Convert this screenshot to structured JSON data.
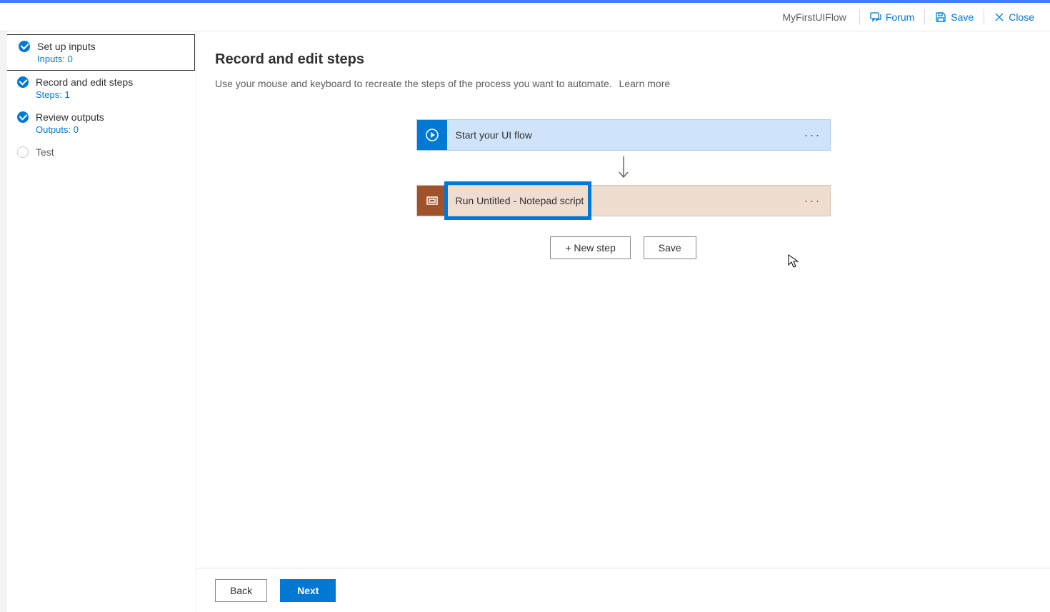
{
  "header": {
    "flowName": "MyFirstUIFlow",
    "forum": "Forum",
    "save": "Save",
    "close": "Close"
  },
  "sidebar": {
    "items": [
      {
        "title": "Set up inputs",
        "sub": "Inputs: 0",
        "status": "done",
        "selected": true
      },
      {
        "title": "Record and edit steps",
        "sub": "Steps: 1",
        "status": "done",
        "selected": false
      },
      {
        "title": "Review outputs",
        "sub": "Outputs: 0",
        "status": "done",
        "selected": false
      },
      {
        "title": "Test",
        "sub": "",
        "status": "empty",
        "selected": false
      }
    ]
  },
  "page": {
    "title": "Record and edit steps",
    "desc": "Use your mouse and keyboard to recreate the steps of the process you want to automate.",
    "learnMore": "Learn more"
  },
  "flow": {
    "step1": "Start your UI flow",
    "step2": "Run Untitled - Notepad script",
    "newStep": "+ New step",
    "save": "Save"
  },
  "footer": {
    "back": "Back",
    "next": "Next"
  }
}
